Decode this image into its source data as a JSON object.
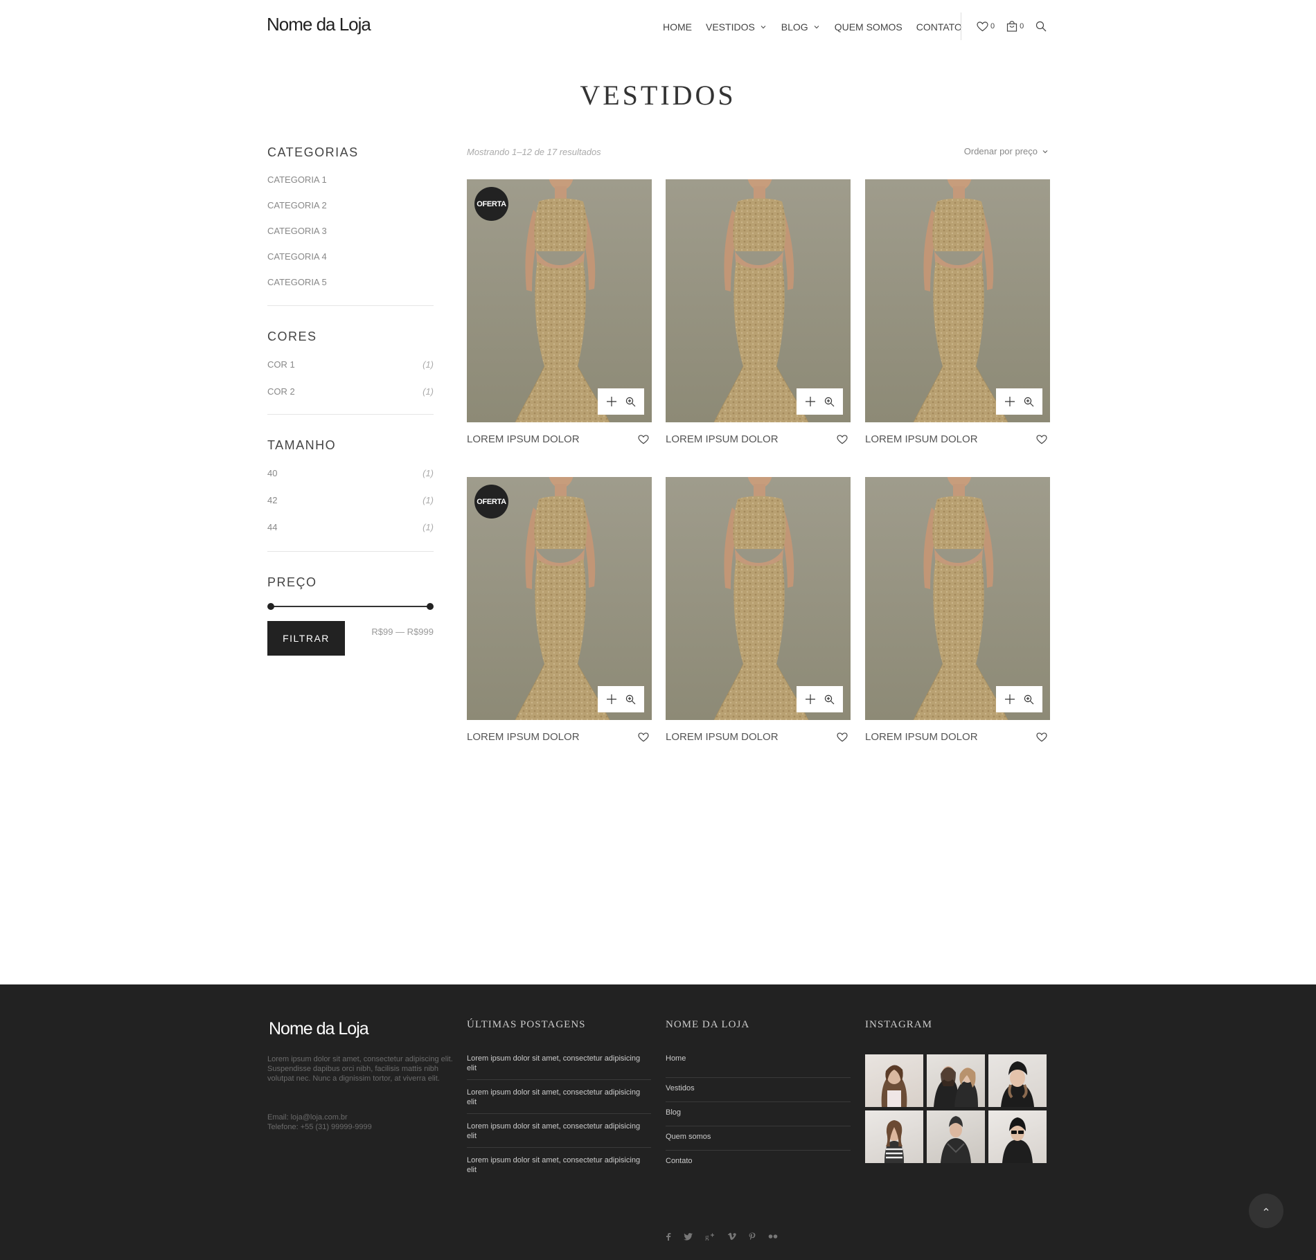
{
  "header": {
    "logo": "Nome da Loja",
    "nav": [
      {
        "label": "HOME"
      },
      {
        "label": "VESTIDOS"
      },
      {
        "label": "BLOG"
      },
      {
        "label": "QUEM SOMOS"
      },
      {
        "label": "CONTATO"
      }
    ],
    "wishlist_count": "0",
    "cart_count": "0"
  },
  "page_title": "VESTIDOS",
  "sidebar": {
    "categories_title": "CATEGORIAS",
    "categories": [
      "CATEGORIA 1",
      "CATEGORIA 2",
      "CATEGORIA 3",
      "CATEGORIA 4",
      "CATEGORIA 5"
    ],
    "colors_title": "CORES",
    "colors": [
      {
        "label": "COR 1",
        "count": "(1)"
      },
      {
        "label": "COR 2",
        "count": "(1)"
      }
    ],
    "sizes_title": "TAMANHO",
    "sizes": [
      {
        "label": "40",
        "count": "(1)"
      },
      {
        "label": "42",
        "count": "(1)"
      },
      {
        "label": "44",
        "count": "(1)"
      }
    ],
    "price_title": "PREÇO",
    "price_slider": {
      "min_fraction": 0.0,
      "max_fraction": 1.0
    },
    "filter_button": "FILTRAR",
    "price_range": "R$99 — R$999"
  },
  "products_header": {
    "result_count": "Mostrando 1–12 de 17 resultados",
    "sort_label": "Ordenar por preço"
  },
  "products": [
    {
      "name": "LOREM IPSUM DOLOR",
      "badge": "OFERTA"
    },
    {
      "name": "LOREM IPSUM DOLOR",
      "badge": ""
    },
    {
      "name": "LOREM IPSUM DOLOR",
      "badge": ""
    },
    {
      "name": "LOREM IPSUM DOLOR",
      "badge": "OFERTA"
    },
    {
      "name": "LOREM IPSUM DOLOR",
      "badge": ""
    },
    {
      "name": "LOREM IPSUM DOLOR",
      "badge": ""
    }
  ],
  "footer": {
    "logo": "Nome da Loja",
    "description": "Lorem ipsum dolor sit amet, consectetur adipiscing elit. Suspendisse dapibus orci nibh, facilisis mattis nibh volutpat nec. Nunc a dignissim tortor, at viverra elit.",
    "email": "Email: loja@loja.com.br",
    "phone": "Telefone: +55 (31) 99999-9999",
    "posts_title": "ÚLTIMAS POSTAGENS",
    "posts": [
      "Lorem ipsum dolor sit amet, consectetur adipisicing elit",
      "Lorem ipsum dolor sit amet, consectetur adipisicing elit",
      "Lorem ipsum dolor sit amet, consectetur adipisicing elit",
      "Lorem ipsum dolor sit amet, consectetur adipisicing elit"
    ],
    "links_title": "NOME DA LOJA",
    "links": [
      "Home",
      "Vestidos",
      "Blog",
      "Quem somos",
      "Contato"
    ],
    "instagram_title": "INSTAGRAM",
    "social_icons": [
      "facebook-icon",
      "twitter-icon",
      "google-plus-icon",
      "vimeo-icon",
      "pinterest-icon",
      "flickr-icon"
    ]
  },
  "colors": {
    "accent_dark": "#222222",
    "footer_bg": "#222222",
    "product_bg": "#9b9781",
    "dress_gold": "#b9a172"
  }
}
